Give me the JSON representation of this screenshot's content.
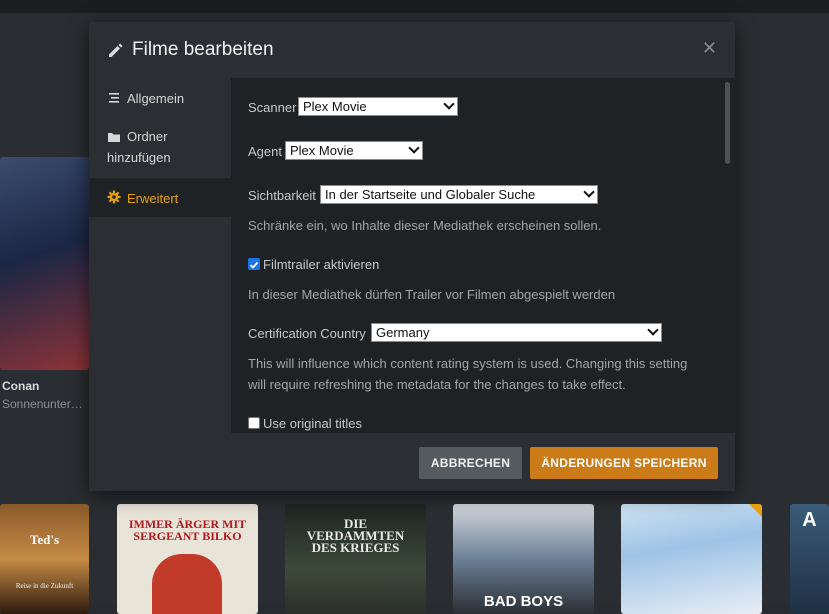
{
  "background": {
    "side_poster": {
      "title": "Conan",
      "subtitle": "Sonnenunter…"
    },
    "posters": [
      {
        "title": "Ted's",
        "subtitle": "Reise in die Zukunft"
      },
      {
        "title": "IMMER ÄRGER MIT SERGEANT BILKO"
      },
      {
        "title": "DIE VERDAMMTEN DES KRIEGES"
      },
      {
        "title": "BAD BOYS"
      },
      {
        "title": ""
      },
      {
        "title": "A"
      }
    ]
  },
  "dialog": {
    "title": "Filme bearbeiten",
    "icon": "pencil-icon",
    "close_label": "✕"
  },
  "sidebar": {
    "items": [
      {
        "label": "Allgemein",
        "icon": "list-icon",
        "active": false
      },
      {
        "label": "Ordner hinzufügen",
        "label_line1": "Ordner",
        "label_line2": "hinzufügen",
        "icon": "folder-icon",
        "active": false
      },
      {
        "label": "Erweitert",
        "icon": "gear-icon",
        "active": true
      }
    ]
  },
  "settings": {
    "scanner": {
      "label": "Scanner",
      "value": "Plex Movie"
    },
    "agent": {
      "label": "Agent",
      "value": "Plex Movie"
    },
    "visibility": {
      "label": "Sichtbarkeit",
      "value": "In der Startseite und Globaler Suche",
      "help": "Schränke ein, wo Inhalte dieser Mediathek erscheinen sollen."
    },
    "trailers": {
      "label": "Filmtrailer aktivieren",
      "checked": true,
      "help": "In dieser Mediathek dürfen Trailer vor Filmen abgespielt werden"
    },
    "certification": {
      "label": "Certification Country",
      "value": "Germany",
      "help_line1": "This will influence which content rating system is used. Changing this setting",
      "help_line2": "will require refreshing the metadata for the changes to take effect."
    },
    "original_titles": {
      "label": "Use original titles",
      "checked": false
    }
  },
  "footer": {
    "cancel_label": "ABBRECHEN",
    "save_label": "ÄNDERUNGEN SPEICHERN"
  },
  "colors": {
    "accent": "#e5a00d",
    "save_button": "#cc7b19",
    "checkbox": "#1a73e8"
  }
}
